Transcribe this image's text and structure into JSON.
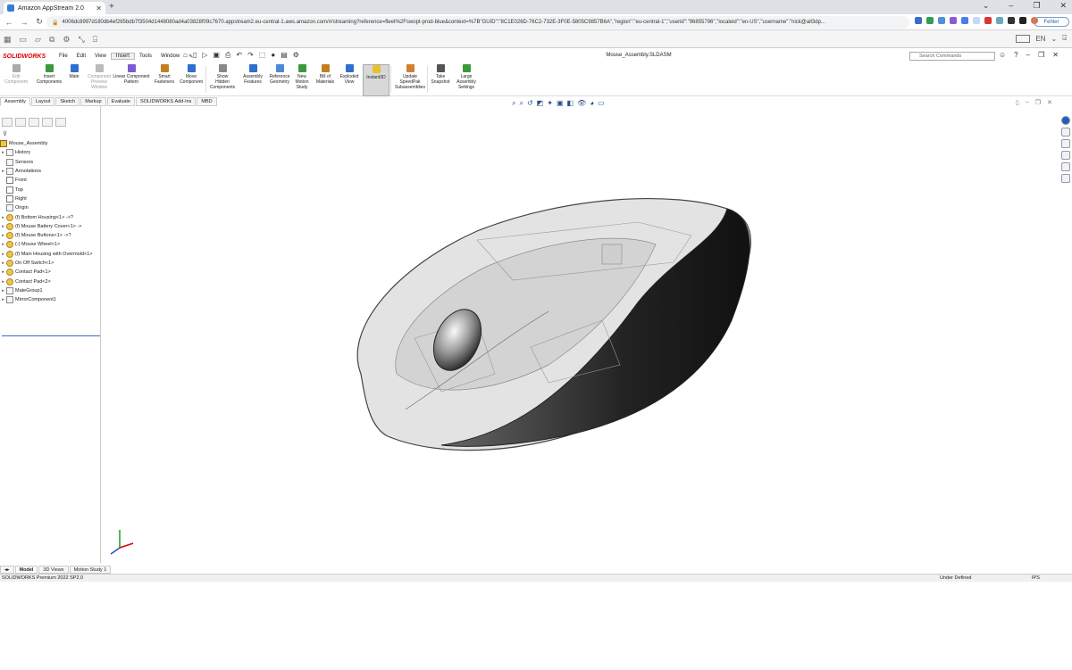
{
  "browser": {
    "tab_title": "Amazon AppStream 2.0",
    "url": "4006dc8997d180db4ef265bdb7f3504d1448080ad4a03828f09c7670.appstream2.eu-central-1.aws.amazon.com/#/streaming?reference=fleet%2Fswopt-prod-blue&context=%7B\"GUID\":\"8C1E026D-76C2-732E-3F0E-5805C9857B6A\",\"region\":\"eu-central-1\",\"userid\":\"96855796\",\"localeid\":\"en-US\",\"username\":\"nick@all3dp...",
    "profile_label": "Fehler"
  },
  "appstream": {
    "right_label": "EN"
  },
  "solidworks": {
    "logo": "SOLIDWORKS",
    "menu": [
      "File",
      "Edit",
      "View",
      "Insert",
      "Tools",
      "Window"
    ],
    "document_title": "Mouse_Assembly.SLDASM",
    "search_placeholder": "Search Commands"
  },
  "ribbon": {
    "buttons": [
      {
        "label": "Edit\nComponent",
        "dim": true
      },
      {
        "label": "Insert\nComponents"
      },
      {
        "label": "Mate"
      },
      {
        "label": "Component\nPreview\nWindow",
        "dim": true
      },
      {
        "label": "Linear Component\nPattern"
      },
      {
        "label": "Smart\nFasteners"
      },
      {
        "label": "Move\nComponent"
      },
      {
        "label": "Show\nHidden\nComponents"
      },
      {
        "label": "Assembly\nFeatures"
      },
      {
        "label": "Reference\nGeometry"
      },
      {
        "label": "New\nMotion\nStudy"
      },
      {
        "label": "Bill of\nMaterials"
      },
      {
        "label": "Exploded\nView"
      },
      {
        "label": "Instant3D",
        "selected": true
      },
      {
        "label": "Update\nSpeedPak\nSubassemblies"
      },
      {
        "label": "Take\nSnapshot"
      },
      {
        "label": "Large\nAssembly\nSettings"
      }
    ]
  },
  "cm_tabs": [
    "Assembly",
    "Layout",
    "Sketch",
    "Markup",
    "Evaluate",
    "SOLIDWORKS Add-Ins",
    "MBD"
  ],
  "tree": {
    "root": "Mouse_Assembly",
    "items": [
      {
        "label": "History",
        "icon": "history-icon",
        "expand": true
      },
      {
        "label": "Sensors",
        "icon": "sensor-icon"
      },
      {
        "label": "Annotations",
        "icon": "annotation-icon",
        "expand": true
      },
      {
        "label": "Front",
        "icon": "plane-icon"
      },
      {
        "label": "Top",
        "icon": "plane-icon"
      },
      {
        "label": "Right",
        "icon": "plane-icon"
      },
      {
        "label": "Origin",
        "icon": "origin-icon"
      },
      {
        "label": "(f) Bottom Housing<1> ->?",
        "icon": "part-icon",
        "expand": true
      },
      {
        "label": "(f) Mouse Battery Cover<1> ->",
        "icon": "part-icon",
        "expand": true
      },
      {
        "label": "(f) Mouse Buttons<1> ->?",
        "icon": "part-icon",
        "expand": true
      },
      {
        "label": "(-) Mouse Wheel<1>",
        "icon": "part-icon",
        "expand": true
      },
      {
        "label": "(f) Main Housing with Overmold<1>",
        "icon": "part-icon",
        "expand": true
      },
      {
        "label": "On Off Switch<1>",
        "icon": "part-icon",
        "expand": true
      },
      {
        "label": "Contact Pad<1>",
        "icon": "part-icon",
        "expand": true
      },
      {
        "label": "Contact Pad<2>",
        "icon": "part-icon",
        "expand": true
      },
      {
        "label": "MateGroup1",
        "icon": "mate-icon",
        "expand": true
      },
      {
        "label": "MirrorComponent1",
        "icon": "mirror-icon",
        "expand": true
      }
    ]
  },
  "bottom_tabs": [
    "Model",
    "3D Views",
    "Motion Study 1"
  ],
  "status": {
    "version": "SOLIDWORKS Premium 2022 SP2.0",
    "state": "Under Defined",
    "units": "IPS"
  },
  "colors": {
    "accent": "#1f5fbf",
    "logo_red": "#d00000",
    "part_yellow": "#f0c44a"
  }
}
